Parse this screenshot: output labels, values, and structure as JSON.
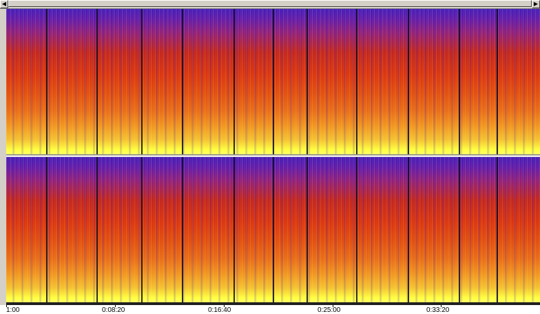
{
  "scrollbar": {
    "left_arrow": "◀",
    "right_arrow": "▶"
  },
  "timeline": {
    "labels": [
      "1:00",
      "0:08:20",
      "0:16:40",
      "0:25:00",
      "0:33:20"
    ]
  },
  "spectrogram": {
    "channels": 2,
    "colormap": [
      "#3a17b8",
      "#c0201e",
      "#f09020",
      "#ffff40"
    ]
  }
}
